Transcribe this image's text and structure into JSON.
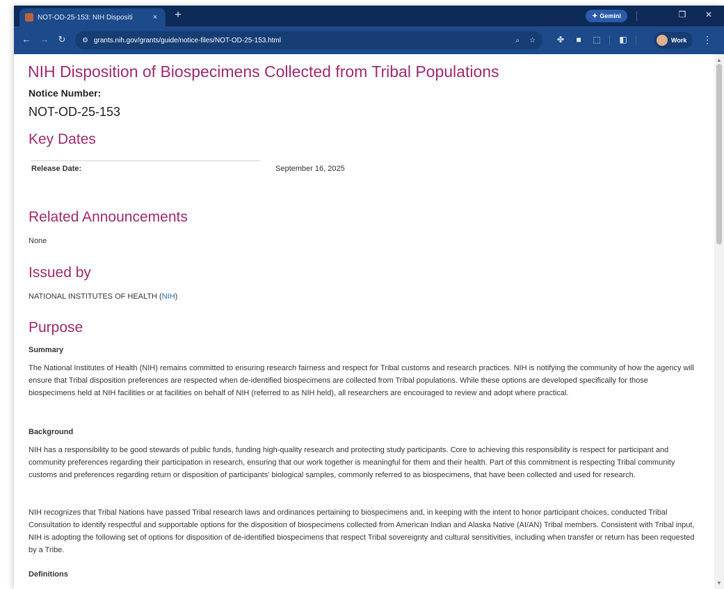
{
  "browser": {
    "tab_title": "NOT-OD-25-153: NIH Dispositi",
    "tab_close": "×",
    "new_tab": "+",
    "gemini_label": "Gemini",
    "url": "grants.nih.gov/grants/guide/notice-files/NOT-OD-25-153.html",
    "profile_label": "Work",
    "icons": [
      "back-icon",
      "forward-icon",
      "reload-icon",
      "site-info-icon",
      "zoom-icon",
      "star-icon",
      "extensions-icon",
      "reading-list-icon",
      "download-icon",
      "split-screen-icon",
      "menu-icon"
    ]
  },
  "page": {
    "title": "NIH Disposition of Biospecimens Collected from Tribal Populations",
    "notice_number_label": "Notice Number:",
    "notice_number": "NOT-OD-25-153",
    "key_dates": {
      "heading": "Key Dates",
      "release_label": "Release Date:",
      "release_value": "September 16, 2025"
    },
    "related": {
      "heading": "Related Announcements",
      "value": "None"
    },
    "issued_by": {
      "heading": "Issued by",
      "org": "NATIONAL INSTITUTES OF HEALTH (",
      "link": "NIH",
      "close": ")"
    },
    "purpose": {
      "heading": "Purpose",
      "summary_heading": "Summary",
      "summary": "The National Institutes of Health (NIH) remains committed to ensuring research fairness and respect for Tribal customs and research practices. NIH is notifying the community of how the agency will ensure that Tribal disposition preferences are respected when de-identified biospecimens are collected from Tribal populations. While these options are developed specifically for those biospecimens held at NIH facilities or at facilities on behalf of NIH (referred to as NIH held), all researchers are encouraged to review and adopt where practical.",
      "background_heading": "Background",
      "background_1": "NIH has a responsibility to be good stewards of public funds, funding high-quality research and protecting study participants. Core to achieving this responsibility is respect for participant and community preferences regarding their participation in research, ensuring that our work together is meaningful for them and their health. Part of this commitment is respecting Tribal community customs and preferences regarding return or disposition of participants' biological samples, commonly referred to as biospecimens, that have been collected and used for research.",
      "background_2": "NIH recognizes that Tribal Nations have passed Tribal research laws and ordinances pertaining to biospecimens and, in keeping with the intent to honor participant choices, conducted Tribal Consultation to identify respectful and supportable options for the disposition of biospecimens collected from American Indian and Alaska Native (AI/AN) Tribal members. Consistent with Tribal input, NIH is adopting the following set of options for disposition of de-identified biospecimens that respect Tribal sovereignty and cultural sensitivities, including when transfer or return has been requested by a Tribe.",
      "definitions_heading": "Definitions"
    }
  }
}
